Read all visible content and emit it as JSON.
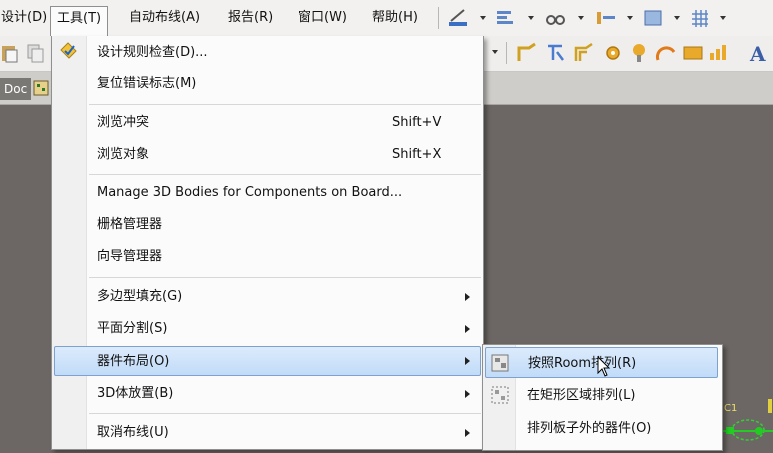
{
  "menubar": {
    "items": [
      {
        "label": "设计(D)"
      },
      {
        "label": "工具(T)"
      },
      {
        "label": "自动布线(A)"
      },
      {
        "label": "报告(R)"
      },
      {
        "label": "窗口(W)"
      },
      {
        "label": "帮助(H)"
      }
    ]
  },
  "doc_tab": {
    "label": "Doc"
  },
  "tools_menu": {
    "items": [
      {
        "label": "设计规则检查(D)...",
        "accel": "",
        "submenu": false
      },
      {
        "label": "复位错误标志(M)",
        "accel": "",
        "submenu": false
      },
      {
        "label": "浏览冲突",
        "accel": "Shift+V",
        "submenu": false
      },
      {
        "label": "浏览对象",
        "accel": "Shift+X",
        "submenu": false
      },
      {
        "label": "Manage 3D Bodies for Components on Board...",
        "accel": "",
        "submenu": false
      },
      {
        "label": "栅格管理器",
        "accel": "",
        "submenu": false
      },
      {
        "label": "向导管理器",
        "accel": "",
        "submenu": false
      },
      {
        "label": "多边型填充(G)",
        "accel": "",
        "submenu": true
      },
      {
        "label": "平面分割(S)",
        "accel": "",
        "submenu": true
      },
      {
        "label": "器件布局(O)",
        "accel": "",
        "submenu": true,
        "highlighted": true
      },
      {
        "label": "3D体放置(B)",
        "accel": "",
        "submenu": true
      },
      {
        "label": "取消布线(U)",
        "accel": "",
        "submenu": true
      }
    ]
  },
  "submenu": {
    "items": [
      {
        "label": "按照Room排列(R)",
        "highlighted": true
      },
      {
        "label": "在矩形区域排列(L)"
      },
      {
        "label": "排列板子外的器件(O)"
      }
    ]
  },
  "schematic": {
    "ref_label": "C1"
  },
  "colors": {
    "workspace": "#6c6764",
    "highlight": "#c1dbf8",
    "highlight_border": "#7da2ce"
  }
}
